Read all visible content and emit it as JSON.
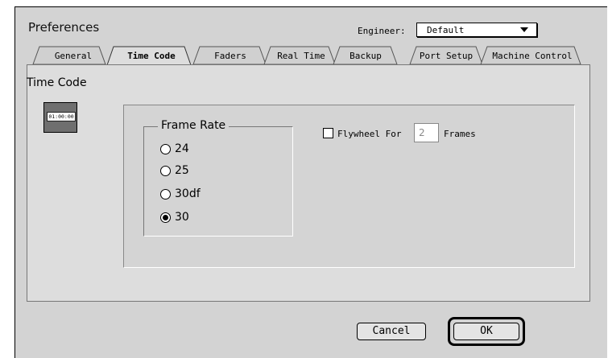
{
  "window": {
    "title": "Preferences"
  },
  "engineer": {
    "label": "Engineer:",
    "selected": "Default"
  },
  "tabs": [
    {
      "label": "General",
      "active": false
    },
    {
      "label": "Time Code",
      "active": true
    },
    {
      "label": "Faders",
      "active": false
    },
    {
      "label": "Real Time",
      "active": false
    },
    {
      "label": "Backup",
      "active": false
    },
    {
      "label": "Port Setup",
      "active": false
    },
    {
      "label": "Machine Control",
      "active": false
    }
  ],
  "panel": {
    "title": "Time Code",
    "icon": {
      "name": "time-code-icon",
      "digits": "01:00:00"
    },
    "frame_rate": {
      "title": "Frame Rate",
      "options": [
        "24",
        "25",
        "30df",
        "30"
      ],
      "selected": "30"
    },
    "flywheel": {
      "label": "Flywheel For",
      "checked": false,
      "value": "2",
      "units": "Frames"
    }
  },
  "buttons": {
    "cancel": "Cancel",
    "ok": "OK"
  },
  "colors": {
    "dialog_bg": "#d3d3d3",
    "panel_bg": "#dddddd",
    "text": "#000000"
  }
}
